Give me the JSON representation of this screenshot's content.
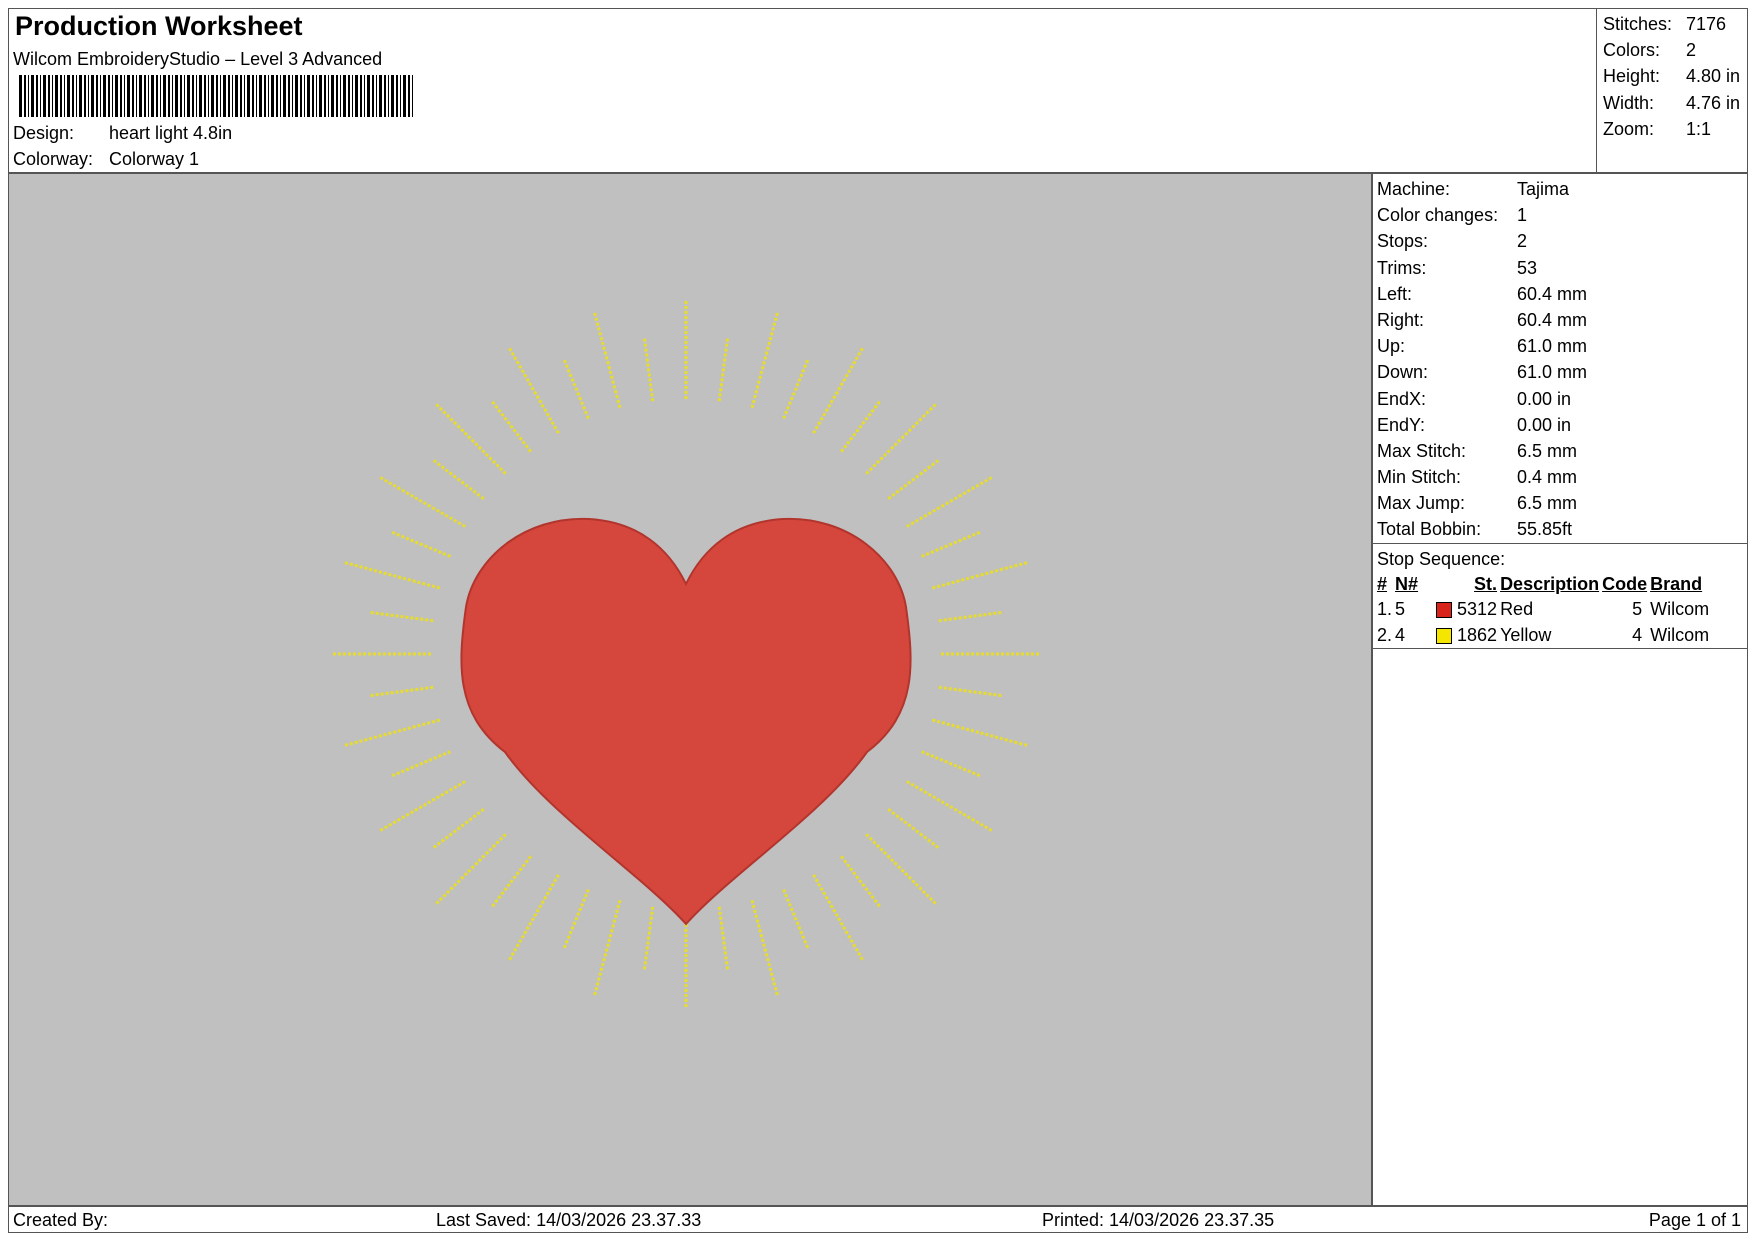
{
  "header": {
    "title": "Production Worksheet",
    "subtitle": "Wilcom EmbroideryStudio – Level 3 Advanced",
    "design_label": "Design:",
    "design_value": "heart light 4.8in",
    "colorway_label": "Colorway:",
    "colorway_value": "Colorway 1"
  },
  "summary": [
    {
      "label": "Stitches:",
      "value": "7176"
    },
    {
      "label": "Colors:",
      "value": "2"
    },
    {
      "label": "Height:",
      "value": "4.80 in"
    },
    {
      "label": "Width:",
      "value": "4.76 in"
    },
    {
      "label": "Zoom:",
      "value": "1:1"
    }
  ],
  "machine": [
    {
      "label": "Machine:",
      "value": "Tajima"
    },
    {
      "label": "Color changes:",
      "value": "1"
    },
    {
      "label": "Stops:",
      "value": "2"
    },
    {
      "label": "Trims:",
      "value": "53"
    },
    {
      "label": "Left:",
      "value": "60.4 mm"
    },
    {
      "label": "Right:",
      "value": "60.4 mm"
    },
    {
      "label": "Up:",
      "value": "61.0 mm"
    },
    {
      "label": "Down:",
      "value": "61.0 mm"
    },
    {
      "label": "EndX:",
      "value": "0.00 in"
    },
    {
      "label": "EndY:",
      "value": "0.00 in"
    },
    {
      "label": "Max Stitch:",
      "value": "6.5 mm"
    },
    {
      "label": "Min Stitch:",
      "value": "0.4 mm"
    },
    {
      "label": "Max Jump:",
      "value": "6.5 mm"
    },
    {
      "label": "Total Bobbin:",
      "value": "55.85ft"
    }
  ],
  "stop_sequence": {
    "caption": "Stop Sequence:",
    "headers": {
      "num": "#",
      "needle": "N#",
      "st": "St.",
      "description": "Description",
      "code": "Code",
      "brand": "Brand"
    },
    "rows": [
      {
        "num": "1.",
        "needle": "5",
        "color": "#d9241c",
        "st": "5312",
        "description": "Red",
        "code": "5",
        "brand": "Wilcom"
      },
      {
        "num": "2.",
        "needle": "4",
        "color": "#f5e600",
        "st": "1862",
        "description": "Yellow",
        "code": "4",
        "brand": "Wilcom"
      }
    ]
  },
  "design_colors": {
    "heart": "#d5463c",
    "rays": "#e7dc2c",
    "background": "#c0c0c0"
  },
  "footer": {
    "created": "Created By:",
    "saved": "Last Saved: 14/03/2026 23.37.33",
    "printed": "Printed: 14/03/2026 23.37.35",
    "page": "Page 1 of 1"
  }
}
